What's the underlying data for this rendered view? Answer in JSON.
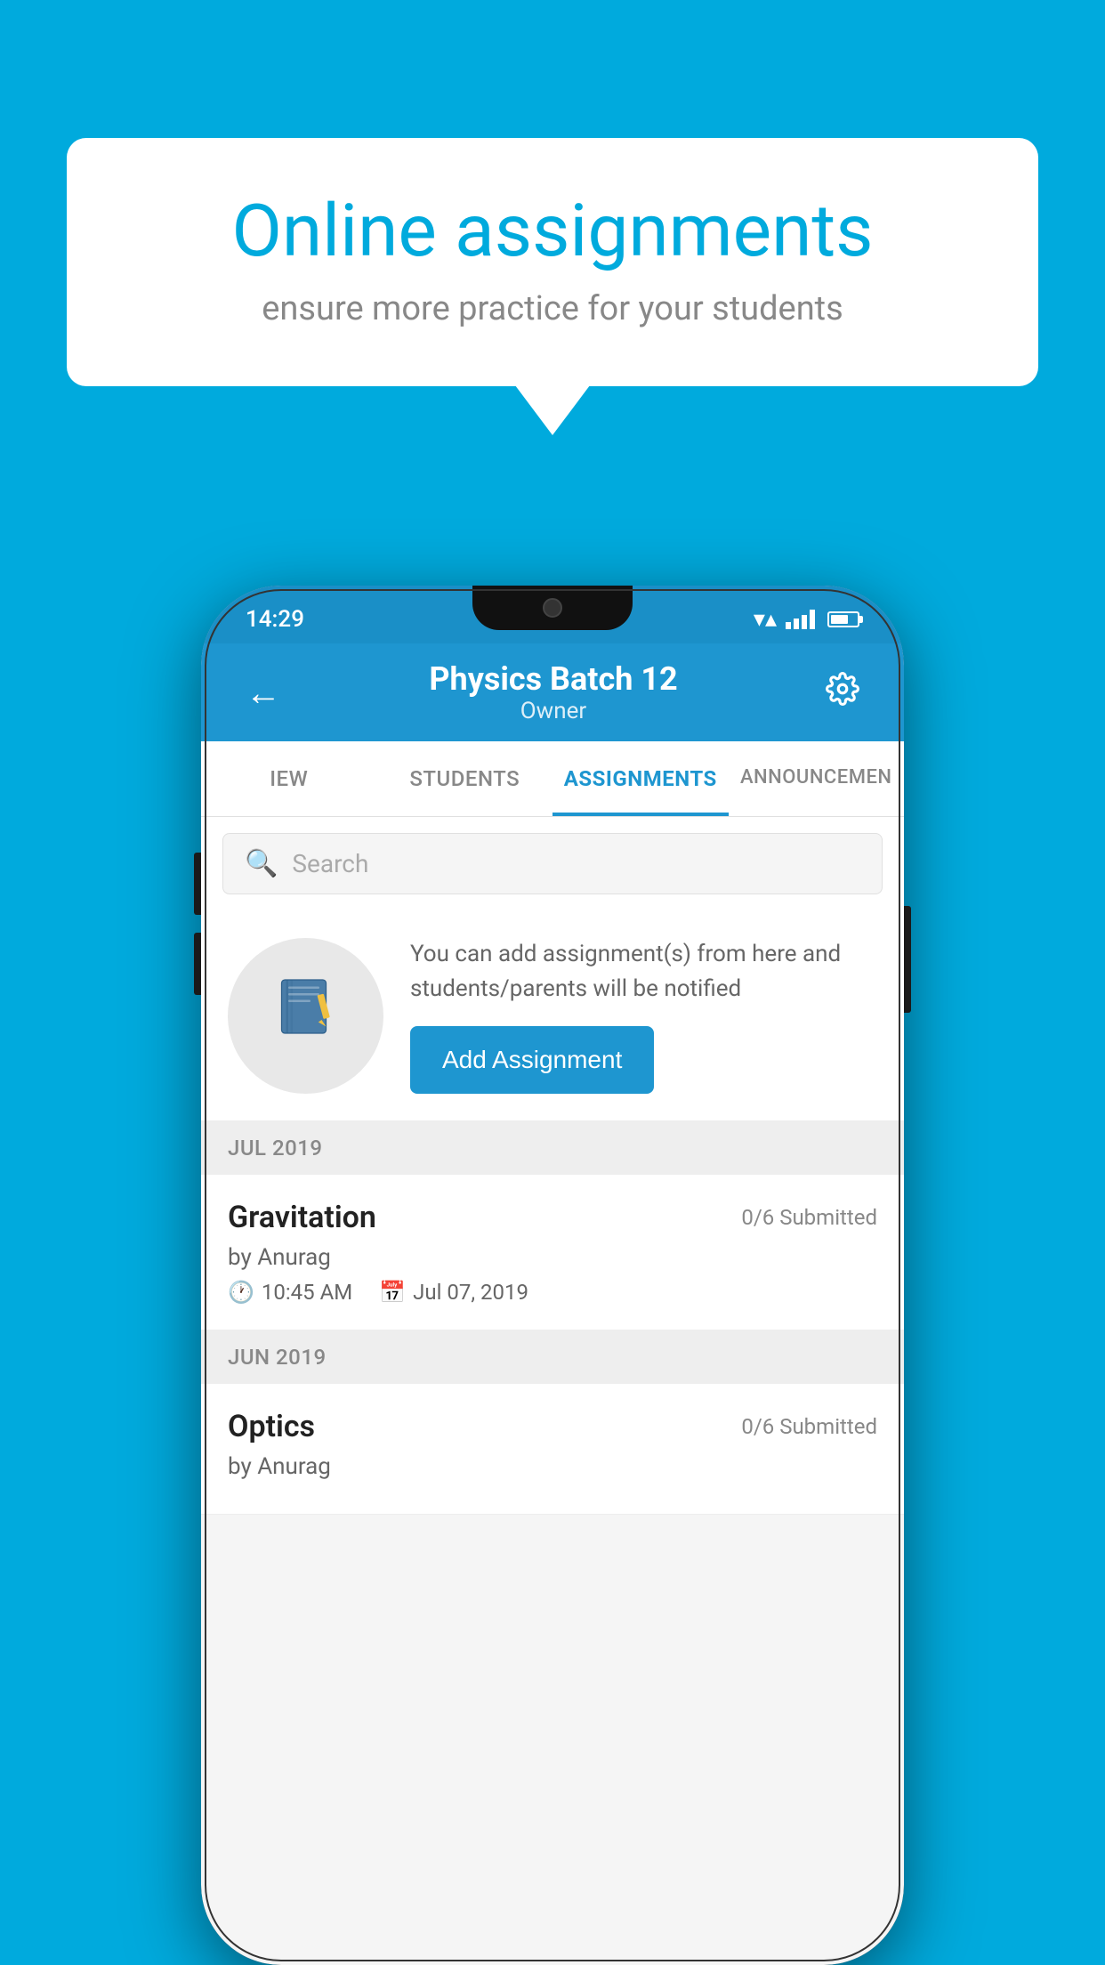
{
  "background": {
    "color": "#00AADD"
  },
  "speech_bubble": {
    "title": "Online assignments",
    "subtitle": "ensure more practice for your students"
  },
  "phone": {
    "status_bar": {
      "time": "14:29"
    },
    "header": {
      "title": "Physics Batch 12",
      "subtitle": "Owner",
      "back_label": "←",
      "settings_label": "⚙"
    },
    "tabs": [
      {
        "label": "IEW",
        "active": false
      },
      {
        "label": "STUDENTS",
        "active": false
      },
      {
        "label": "ASSIGNMENTS",
        "active": true
      },
      {
        "label": "ANNOUNCEMENTS",
        "active": false
      }
    ],
    "search": {
      "placeholder": "Search"
    },
    "promo": {
      "text": "You can add assignment(s) from here and students/parents will be notified",
      "button_label": "Add Assignment"
    },
    "sections": [
      {
        "label": "JUL 2019",
        "assignments": [
          {
            "name": "Gravitation",
            "submitted": "0/6 Submitted",
            "by": "by Anurag",
            "time": "10:45 AM",
            "date": "Jul 07, 2019"
          }
        ]
      },
      {
        "label": "JUN 2019",
        "assignments": [
          {
            "name": "Optics",
            "submitted": "0/6 Submitted",
            "by": "by Anurag",
            "time": "",
            "date": ""
          }
        ]
      }
    ]
  }
}
